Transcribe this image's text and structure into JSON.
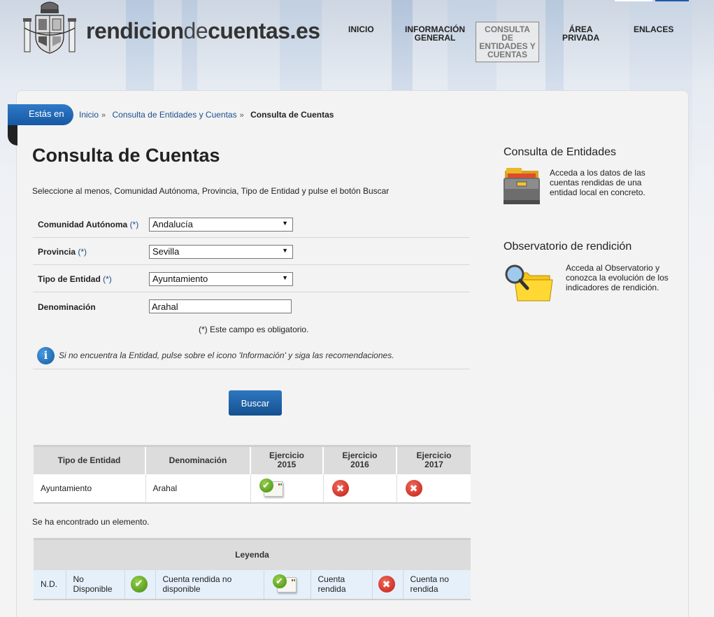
{
  "header": {
    "site_title_bold": "rendicion",
    "site_title_light": "de",
    "site_title_bold2": "cuentas.es"
  },
  "nav": {
    "items": [
      {
        "label_l1": "INICIO",
        "label_l2": "",
        "label_l3": ""
      },
      {
        "label_l1": "INFORMACIÓN",
        "label_l2": "GENERAL",
        "label_l3": ""
      },
      {
        "label_l1": "CONSULTA DE",
        "label_l2": "ENTIDADES Y",
        "label_l3": "CUENTAS"
      },
      {
        "label_l1": "ÁREA",
        "label_l2": "PRIVADA",
        "label_l3": ""
      },
      {
        "label_l1": "ENLACES",
        "label_l2": "",
        "label_l3": ""
      }
    ]
  },
  "breadcrumb": {
    "tab_label": "Estás en",
    "items": [
      "Inicio",
      "Consulta de Entidades y Cuentas",
      "Consulta de Cuentas"
    ],
    "separator": "»"
  },
  "main": {
    "title": "Consulta de Cuentas",
    "intro": "Seleccione al menos, Comunidad Autónoma, Provincia, Tipo de Entidad y pulse el botón Buscar",
    "form": {
      "comunidad": {
        "label": "Comunidad Autónoma",
        "req": "(*)",
        "value": "Andalucía"
      },
      "provincia": {
        "label": "Provincia",
        "req": "(*)",
        "value": "Sevilla"
      },
      "tipo": {
        "label": "Tipo de Entidad",
        "req": "(*)",
        "value": "Ayuntamiento"
      },
      "denominacion": {
        "label": "Denominación",
        "value": "Arahal"
      }
    },
    "required_note": "(*) Este campo es obligatorio.",
    "info_glyph": "i",
    "info_text": "Si no encuentra la Entidad, pulse sobre el icono 'Información' y siga las recomendaciones.",
    "search_button": "Buscar"
  },
  "results": {
    "headers": {
      "tipo": "Tipo de Entidad",
      "denominacion": "Denominación",
      "ej2015_l1": "Ejercicio",
      "ej2015_l2": "2015",
      "ej2016_l1": "Ejercicio",
      "ej2016_l2": "2016",
      "ej2017_l1": "Ejercicio",
      "ej2017_l2": "2017"
    },
    "row": {
      "tipo": "Ayuntamiento",
      "denominacion": "Arahal",
      "status_2015": "cuenta-rendida",
      "status_2016": "cuenta-no-rendida",
      "status_2017": "cuenta-no-rendida"
    },
    "found_text": "Se ha encontrado un elemento."
  },
  "legend": {
    "title": "Leyenda",
    "nd": "N.D.",
    "nd_text_l1": "No",
    "nd_text_l2": "Disponible",
    "rendida_no_disp_l1": "Cuenta rendida no",
    "rendida_no_disp_l2": "disponible",
    "rendida_l1": "Cuenta",
    "rendida_l2": "rendida",
    "no_rendida_l1": "Cuenta no",
    "no_rendida_l2": "rendida"
  },
  "sidebar": {
    "entidades_title": "Consulta de Entidades",
    "entidades_l1": "Acceda a los datos de las",
    "entidades_l2": "cuentas rendidas de una",
    "entidades_l3": "entidad local en concreto.",
    "observatorio_title": "Observatorio de rendición",
    "observatorio_l1": "Acceda al Observatorio y",
    "observatorio_l2": "conozca la evolución de los",
    "observatorio_l3": "indicadores de rendición."
  },
  "icons": {
    "ok_glyph": "✔",
    "x_glyph": "✖",
    "select_arrow": "▼"
  },
  "colors": {
    "link_blue": "#1a4f8a",
    "button_blue": "#1c5ea6",
    "ok_green": "#4f9a1c",
    "error_red": "#d1281b",
    "folder_yellow": "#f5c518"
  }
}
